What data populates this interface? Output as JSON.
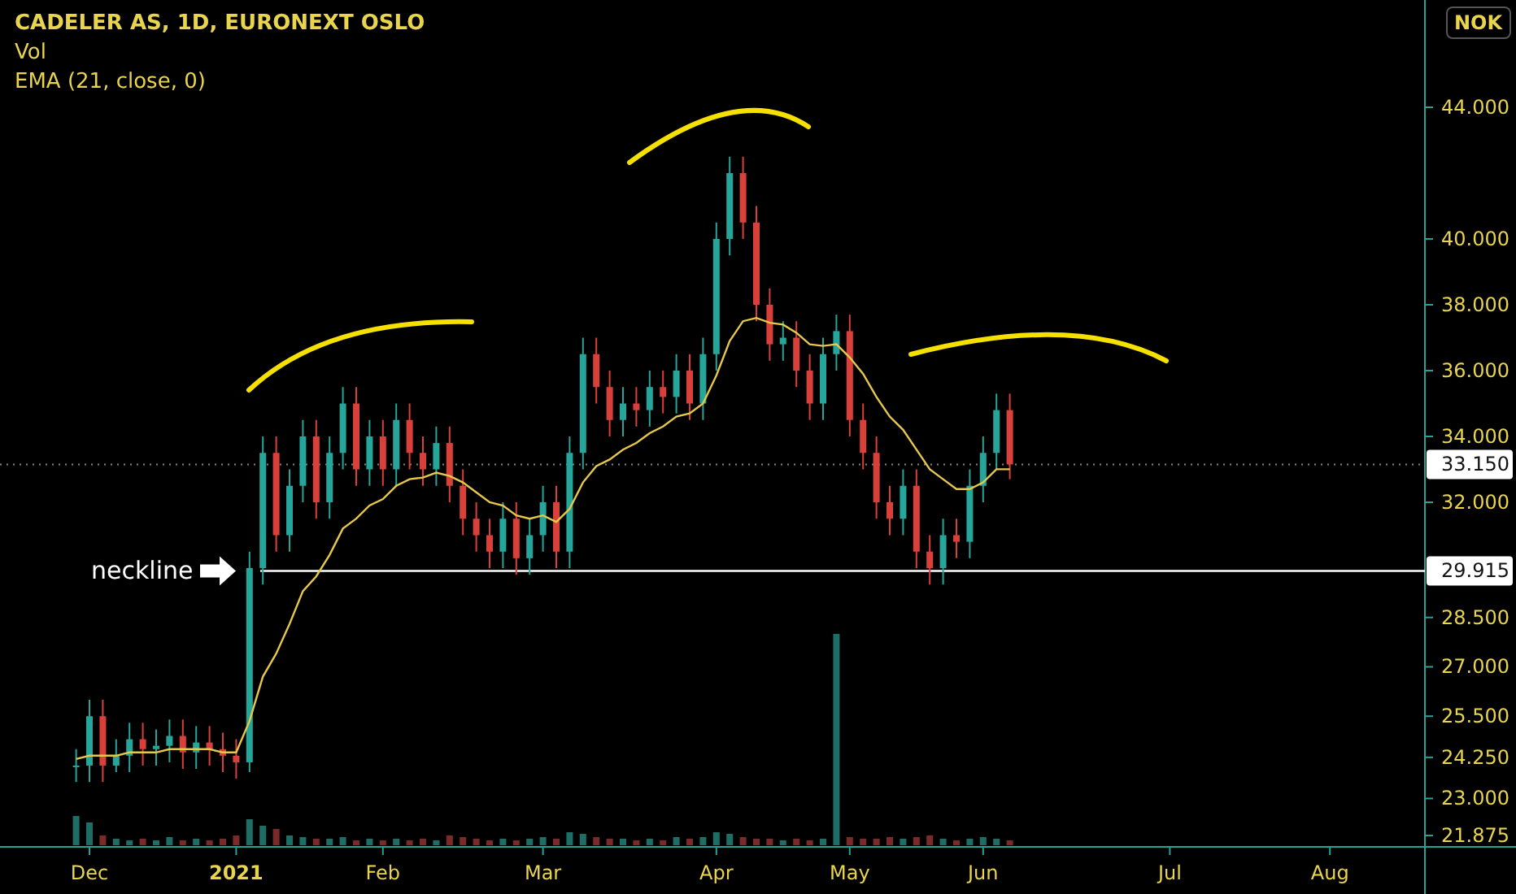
{
  "legend": {
    "title": "CADELER AS, 1D, EURONEXT OSLO",
    "indicators": [
      "Vol"
    ]
  },
  "currency": "NOK",
  "chart_data": {
    "type": "candlestick",
    "ylim": [
      21.53,
      47.26
    ],
    "categories": [
      null,
      "Dec",
      null,
      null,
      null,
      null,
      null,
      null,
      null,
      null,
      null,
      null,
      "2021",
      null,
      null,
      null,
      null,
      null,
      null,
      null,
      null,
      null,
      null,
      "Feb",
      null,
      null,
      null,
      null,
      null,
      null,
      null,
      null,
      null,
      null,
      null,
      "Mar",
      null,
      null,
      null,
      null,
      null,
      null,
      null,
      null,
      null,
      null,
      null,
      null,
      "Apr",
      null,
      null,
      null,
      null,
      null,
      null,
      null,
      null,
      null,
      "May",
      null,
      null,
      null,
      null,
      null,
      null,
      null,
      null,
      null,
      "Jun",
      null,
      null,
      null,
      null,
      null,
      null,
      null,
      null,
      null,
      null,
      null,
      null,
      null,
      "Jul",
      null,
      null,
      null,
      null,
      null,
      null,
      null,
      null,
      null,
      null,
      null,
      "Aug",
      null
    ],
    "ohlc": [
      [
        24.0,
        24.5,
        23.5,
        24.0
      ],
      [
        24.0,
        26.0,
        23.5,
        25.5
      ],
      [
        25.5,
        26.0,
        23.5,
        24.0
      ],
      [
        24.0,
        24.8,
        23.8,
        24.3
      ],
      [
        24.3,
        25.3,
        23.8,
        24.8
      ],
      [
        24.8,
        25.3,
        24.0,
        24.5
      ],
      [
        24.5,
        25.1,
        24.0,
        24.6
      ],
      [
        24.6,
        25.4,
        24.1,
        24.9
      ],
      [
        24.9,
        25.4,
        23.9,
        24.4
      ],
      [
        24.4,
        25.2,
        23.9,
        24.7
      ],
      [
        24.7,
        25.2,
        24.0,
        24.5
      ],
      [
        24.5,
        25.0,
        23.8,
        24.3
      ],
      [
        24.3,
        24.8,
        23.6,
        24.1
      ],
      [
        24.1,
        30.5,
        23.8,
        30.0
      ],
      [
        30.0,
        34.0,
        29.5,
        33.5
      ],
      [
        33.5,
        34.0,
        30.5,
        31.0
      ],
      [
        31.0,
        33.0,
        30.5,
        32.5
      ],
      [
        32.5,
        34.5,
        32.0,
        34.0
      ],
      [
        34.0,
        34.5,
        31.5,
        32.0
      ],
      [
        32.0,
        34.0,
        31.5,
        33.5
      ],
      [
        33.5,
        35.5,
        33.0,
        35.0
      ],
      [
        35.0,
        35.5,
        32.5,
        33.0
      ],
      [
        33.0,
        34.5,
        32.5,
        34.0
      ],
      [
        34.0,
        34.5,
        32.5,
        33.0
      ],
      [
        33.0,
        35.0,
        32.5,
        34.5
      ],
      [
        34.5,
        35.0,
        33.0,
        33.5
      ],
      [
        33.5,
        34.0,
        32.5,
        33.0
      ],
      [
        33.0,
        34.3,
        32.5,
        33.8
      ],
      [
        33.8,
        34.3,
        32.0,
        32.5
      ],
      [
        32.5,
        33.0,
        31.0,
        31.5
      ],
      [
        31.5,
        32.0,
        30.5,
        31.0
      ],
      [
        31.0,
        31.5,
        30.0,
        30.5
      ],
      [
        30.5,
        32.0,
        30.0,
        31.5
      ],
      [
        31.5,
        32.0,
        29.8,
        30.3
      ],
      [
        30.3,
        31.5,
        29.8,
        31.0
      ],
      [
        31.0,
        32.5,
        30.5,
        32.0
      ],
      [
        32.0,
        32.5,
        30.0,
        30.5
      ],
      [
        30.5,
        34.0,
        30.0,
        33.5
      ],
      [
        33.5,
        37.0,
        33.0,
        36.5
      ],
      [
        36.5,
        37.0,
        35.0,
        35.5
      ],
      [
        35.5,
        36.0,
        34.0,
        34.5
      ],
      [
        34.5,
        35.5,
        34.0,
        35.0
      ],
      [
        35.0,
        35.5,
        34.3,
        34.8
      ],
      [
        34.8,
        36.0,
        34.3,
        35.5
      ],
      [
        35.5,
        36.0,
        34.7,
        35.2
      ],
      [
        35.2,
        36.5,
        34.7,
        36.0
      ],
      [
        36.0,
        36.5,
        34.5,
        35.0
      ],
      [
        35.0,
        37.0,
        34.5,
        36.5
      ],
      [
        36.5,
        40.5,
        36.0,
        40.0
      ],
      [
        40.0,
        42.5,
        39.5,
        42.0
      ],
      [
        42.0,
        42.5,
        40.0,
        40.5
      ],
      [
        40.5,
        41.0,
        37.5,
        38.0
      ],
      [
        38.0,
        38.5,
        36.3,
        36.8
      ],
      [
        36.8,
        37.5,
        36.3,
        37.0
      ],
      [
        37.0,
        37.5,
        35.5,
        36.0
      ],
      [
        36.0,
        36.5,
        34.5,
        35.0
      ],
      [
        35.0,
        37.0,
        34.5,
        36.5
      ],
      [
        36.5,
        37.7,
        36.0,
        37.2
      ],
      [
        37.2,
        37.7,
        34.0,
        34.5
      ],
      [
        34.5,
        35.0,
        33.0,
        33.5
      ],
      [
        33.5,
        34.0,
        31.5,
        32.0
      ],
      [
        32.0,
        32.5,
        31.0,
        31.5
      ],
      [
        31.5,
        33.0,
        31.0,
        32.5
      ],
      [
        32.5,
        33.0,
        30.0,
        30.5
      ],
      [
        30.5,
        31.0,
        29.5,
        30.0
      ],
      [
        30.0,
        31.5,
        29.5,
        31.0
      ],
      [
        31.0,
        31.5,
        30.3,
        30.8
      ],
      [
        30.8,
        33.0,
        30.3,
        32.5
      ],
      [
        32.5,
        34.0,
        32.0,
        33.5
      ],
      [
        33.5,
        35.3,
        33.0,
        34.8
      ],
      [
        34.8,
        35.3,
        32.7,
        33.15
      ],
      null,
      null,
      null,
      null,
      null,
      null,
      null,
      null,
      null,
      null,
      null,
      null,
      null,
      null,
      null,
      null,
      null,
      null,
      null,
      null,
      null,
      null,
      null,
      null,
      null
    ],
    "series": [
      {
        "name": "EMA (21, close, 0)",
        "type": "line",
        "color": "#e6c84a",
        "values": [
          24.2,
          24.3,
          24.3,
          24.3,
          24.4,
          24.4,
          24.4,
          24.5,
          24.5,
          24.5,
          24.5,
          24.4,
          24.4,
          25.35,
          26.7,
          27.4,
          28.3,
          29.3,
          29.75,
          30.4,
          31.2,
          31.5,
          31.9,
          32.1,
          32.5,
          32.7,
          32.75,
          32.9,
          32.8,
          32.6,
          32.3,
          32.0,
          31.9,
          31.6,
          31.5,
          31.6,
          31.4,
          31.8,
          32.6,
          33.1,
          33.3,
          33.6,
          33.8,
          34.1,
          34.3,
          34.6,
          34.7,
          35.0,
          35.85,
          36.9,
          37.5,
          37.6,
          37.45,
          37.4,
          37.15,
          36.8,
          36.75,
          36.8,
          36.4,
          35.9,
          35.2,
          34.6,
          34.2,
          33.6,
          33.0,
          32.7,
          32.4,
          32.4,
          32.6,
          33.0,
          33.0,
          null,
          null,
          null,
          null,
          null,
          null,
          null,
          null,
          null,
          null,
          null,
          null,
          null,
          null,
          null,
          null,
          null,
          null,
          null,
          null,
          null,
          null,
          null,
          null,
          null
        ]
      }
    ],
    "yticks": [
      {
        "value": 44,
        "label": "44.000"
      },
      {
        "value": 40,
        "label": "40.000"
      },
      {
        "value": 38,
        "label": "38.000"
      },
      {
        "value": 36,
        "label": "36.000"
      },
      {
        "value": 34,
        "label": "34.000"
      },
      {
        "value": 32,
        "label": "32.000"
      },
      {
        "value": 28.5,
        "label": "28.500"
      },
      {
        "value": 27,
        "label": "27.000"
      },
      {
        "value": 25.5,
        "label": "25.500"
      },
      {
        "value": 24.25,
        "label": "24.250"
      },
      {
        "value": 23,
        "label": "23.000"
      },
      {
        "value": 21.875,
        "label": "21.875"
      }
    ],
    "ref_lines": [
      {
        "axis": "y",
        "value": 33.15,
        "label": "33.150"
      },
      {
        "axis": "y",
        "value": 29.915,
        "label": "29.915"
      }
    ]
  },
  "price_lines": [
    {
      "kind": "last_price"
    },
    {
      "kind": "neckline",
      "text": "neckline"
    }
  ]
}
